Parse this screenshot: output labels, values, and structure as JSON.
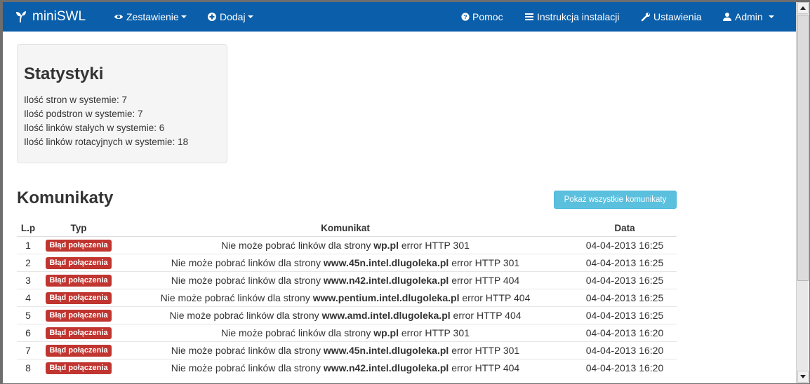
{
  "navbar": {
    "brand": "miniSWL",
    "left_items": [
      {
        "label": "Zestawienie",
        "icon": "eye-icon",
        "dropdown": true
      },
      {
        "label": "Dodaj",
        "icon": "plus-circle-icon",
        "dropdown": true
      }
    ],
    "right_items": [
      {
        "label": "Pomoc",
        "icon": "question-circle-icon",
        "dropdown": false
      },
      {
        "label": "Instrukcja instalacji",
        "icon": "list-icon",
        "dropdown": false
      },
      {
        "label": "Ustawienia",
        "icon": "wrench-icon",
        "dropdown": false
      },
      {
        "label": "Admin",
        "icon": "user-icon",
        "dropdown": true
      }
    ]
  },
  "stats": {
    "title": "Statystyki",
    "lines": [
      "Ilość stron w systemie: 7",
      "Ilość podstron w systemie: 7",
      "Ilość linków stałych w systemie: 6",
      "Ilość linków rotacyjnych w systemie: 18"
    ]
  },
  "messages": {
    "title": "Komunikaty",
    "show_all_button": "Pokaż wszystkie komunikaty",
    "headers": [
      "L.p",
      "Typ",
      "Komunikat",
      "Data"
    ],
    "rows": [
      {
        "lp": "1",
        "type": "Błąd połączenia",
        "prefix": "Nie może pobrać linków dla strony ",
        "site": "wp.pl",
        "suffix": " error HTTP 301",
        "date": "04-04-2013 16:25"
      },
      {
        "lp": "2",
        "type": "Błąd połączenia",
        "prefix": "Nie może pobrać linków dla strony ",
        "site": "www.45n.intel.dlugoleka.pl",
        "suffix": " error HTTP 301",
        "date": "04-04-2013 16:25"
      },
      {
        "lp": "3",
        "type": "Błąd połączenia",
        "prefix": "Nie może pobrać linków dla strony ",
        "site": "www.n42.intel.dlugoleka.pl",
        "suffix": " error HTTP 404",
        "date": "04-04-2013 16:25"
      },
      {
        "lp": "4",
        "type": "Błąd połączenia",
        "prefix": "Nie może pobrać linków dla strony ",
        "site": "www.pentium.intel.dlugoleka.pl",
        "suffix": " error HTTP 404",
        "date": "04-04-2013 16:25"
      },
      {
        "lp": "5",
        "type": "Błąd połączenia",
        "prefix": "Nie może pobrać linków dla strony ",
        "site": "www.amd.intel.dlugoleka.pl",
        "suffix": " error HTTP 404",
        "date": "04-04-2013 16:25"
      },
      {
        "lp": "6",
        "type": "Błąd połączenia",
        "prefix": "Nie może pobrać linków dla strony ",
        "site": "wp.pl",
        "suffix": " error HTTP 301",
        "date": "04-04-2013 16:20"
      },
      {
        "lp": "7",
        "type": "Błąd połączenia",
        "prefix": "Nie może pobrać linków dla strony ",
        "site": "www.45n.intel.dlugoleka.pl",
        "suffix": " error HTTP 301",
        "date": "04-04-2013 16:20"
      },
      {
        "lp": "8",
        "type": "Błąd połączenia",
        "prefix": "Nie może pobrać linków dla strony ",
        "site": "www.n42.intel.dlugoleka.pl",
        "suffix": " error HTTP 404",
        "date": "04-04-2013 16:20"
      }
    ]
  },
  "colors": {
    "navbar": "#0b5ea9",
    "label_danger": "#c03530",
    "button_info": "#5bc0de"
  }
}
